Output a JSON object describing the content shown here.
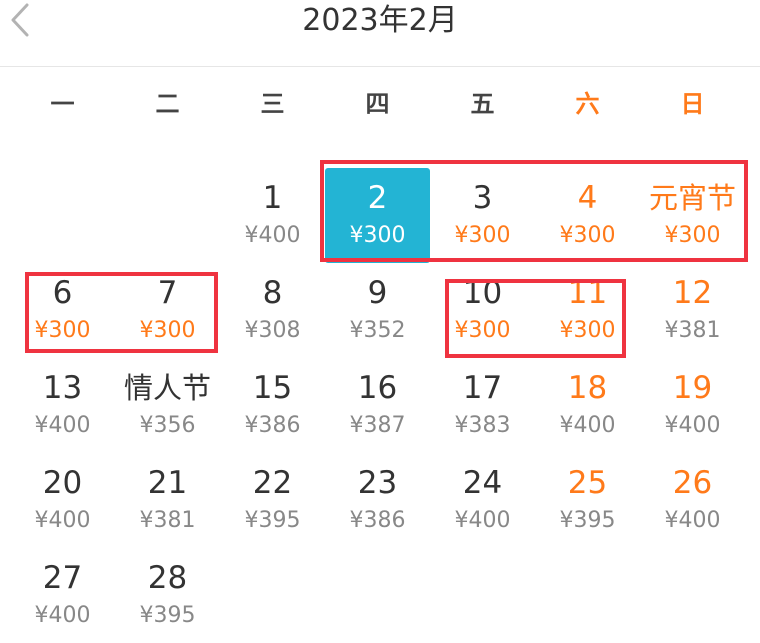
{
  "header": {
    "title": "2023年2月",
    "back_icon": "chevron-left-icon"
  },
  "weekdays": [
    "一",
    "二",
    "三",
    "四",
    "五",
    "六",
    "日"
  ],
  "colors": {
    "accent": "#ff7a1a",
    "selected_bg": "#23b4d4",
    "highlight_box": "#ef3340",
    "text": "#333333",
    "muted": "#888888"
  },
  "calendar": {
    "selected_date": "2",
    "days": [
      {
        "label": "1",
        "price": "¥400"
      },
      {
        "label": "2",
        "price": "¥300"
      },
      {
        "label": "3",
        "price": "¥300"
      },
      {
        "label": "4",
        "price": "¥300"
      },
      {
        "label": "元宵节",
        "price": "¥300"
      },
      {
        "label": "6",
        "price": "¥300"
      },
      {
        "label": "7",
        "price": "¥300"
      },
      {
        "label": "8",
        "price": "¥308"
      },
      {
        "label": "9",
        "price": "¥352"
      },
      {
        "label": "10",
        "price": "¥300"
      },
      {
        "label": "11",
        "price": "¥300"
      },
      {
        "label": "12",
        "price": "¥381"
      },
      {
        "label": "13",
        "price": "¥400"
      },
      {
        "label": "情人节",
        "price": "¥356"
      },
      {
        "label": "15",
        "price": "¥386"
      },
      {
        "label": "16",
        "price": "¥387"
      },
      {
        "label": "17",
        "price": "¥383"
      },
      {
        "label": "18",
        "price": "¥400"
      },
      {
        "label": "19",
        "price": "¥400"
      },
      {
        "label": "20",
        "price": "¥400"
      },
      {
        "label": "21",
        "price": "¥381"
      },
      {
        "label": "22",
        "price": "¥395"
      },
      {
        "label": "23",
        "price": "¥386"
      },
      {
        "label": "24",
        "price": "¥400"
      },
      {
        "label": "25",
        "price": "¥395"
      },
      {
        "label": "26",
        "price": "¥400"
      },
      {
        "label": "27",
        "price": "¥400"
      },
      {
        "label": "28",
        "price": "¥395"
      }
    ]
  }
}
